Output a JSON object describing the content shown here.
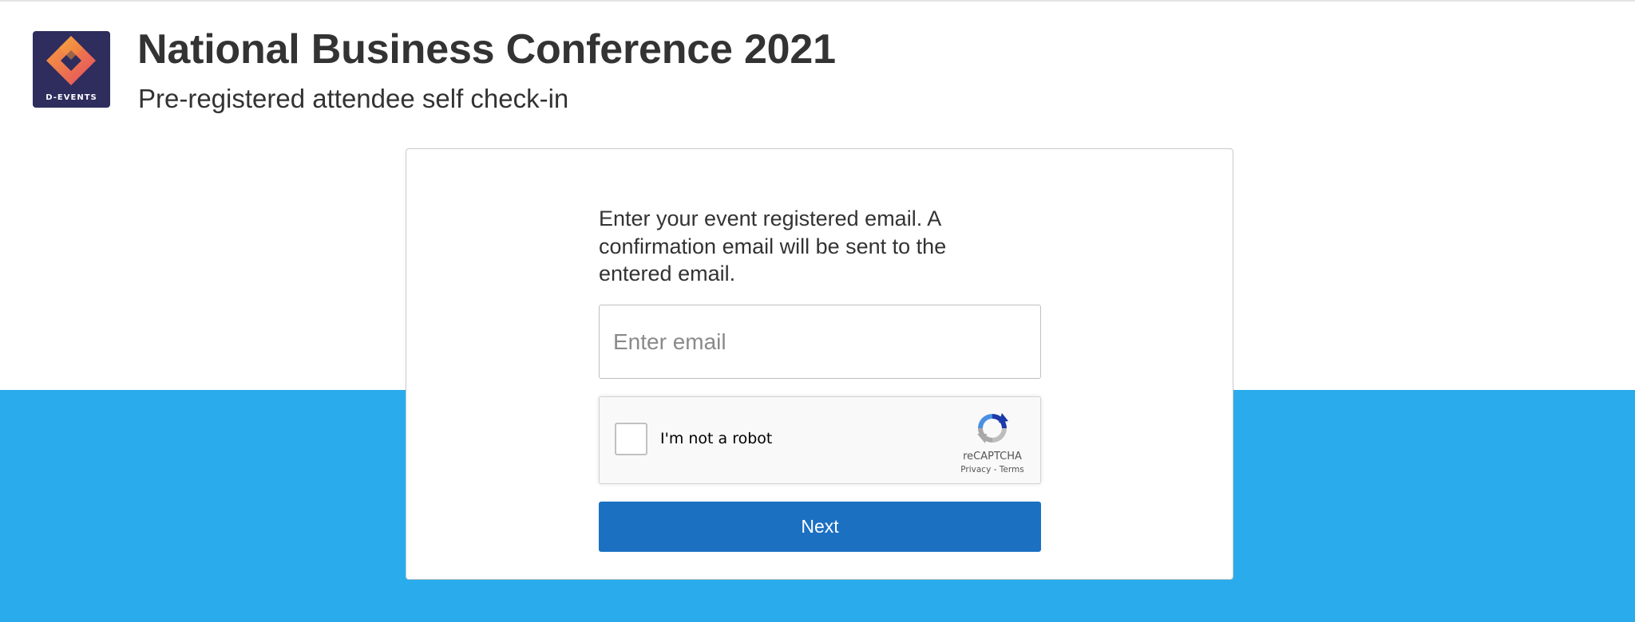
{
  "header": {
    "logo_text": "D-EVENTS",
    "title": "National Business Conference 2021",
    "subtitle": "Pre-registered attendee self check-in"
  },
  "form": {
    "instructions": "Enter your event registered email. A confirmation email will be sent to the entered email.",
    "email_value": "",
    "email_placeholder": "Enter email",
    "next_label": "Next"
  },
  "captcha": {
    "checked": false,
    "label": "I'm not a robot",
    "brand": "reCAPTCHA",
    "privacy_label": "Privacy",
    "separator": "-",
    "terms_label": "Terms",
    "icon": "recaptcha-icon"
  },
  "icons": {
    "logo": "d-events-logo-icon",
    "checkbox": "checkbox-icon"
  },
  "colors": {
    "band": "#2aabec",
    "button": "#1b70c2",
    "logo_bg": "#2e2d5e",
    "logo_orange": "#f08a30",
    "logo_red": "#e34b5d",
    "text": "#333333"
  }
}
